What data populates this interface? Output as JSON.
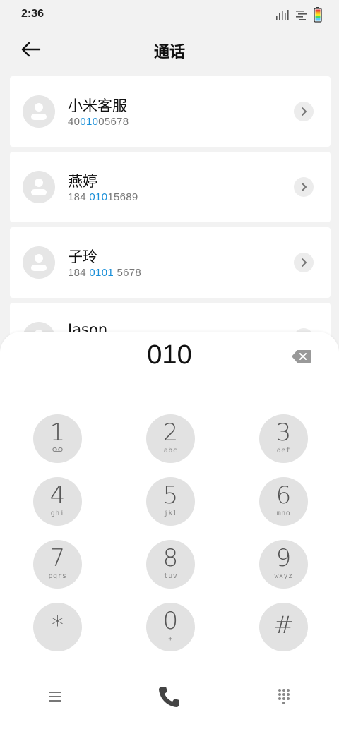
{
  "status_bar": {
    "time": "2:36",
    "icons": [
      "signal-icon",
      "wifi-icon",
      "battery-icon"
    ]
  },
  "header": {
    "title": "通话",
    "back_icon": "arrow-left-icon"
  },
  "contacts": [
    {
      "name": "小米客服",
      "number_parts": [
        "40",
        "010",
        "05678"
      ]
    },
    {
      "name": "燕婷",
      "number_parts": [
        "184 ",
        "010",
        "15689"
      ]
    },
    {
      "name": "子玲",
      "number_parts": [
        "184 ",
        "0101",
        " 5678"
      ]
    },
    {
      "name": "Jason",
      "number_parts": [
        "",
        "",
        ""
      ]
    }
  ],
  "dialer": {
    "input_value": "010",
    "keys": [
      {
        "digit": "1",
        "letters": ""
      },
      {
        "digit": "2",
        "letters": "abc"
      },
      {
        "digit": "3",
        "letters": "def"
      },
      {
        "digit": "4",
        "letters": "ghi"
      },
      {
        "digit": "5",
        "letters": "jkl"
      },
      {
        "digit": "6",
        "letters": "mno"
      },
      {
        "digit": "7",
        "letters": "pqrs"
      },
      {
        "digit": "8",
        "letters": "tuv"
      },
      {
        "digit": "9",
        "letters": "wxyz"
      },
      {
        "digit": "*",
        "letters": ""
      },
      {
        "digit": "0",
        "letters": "+"
      },
      {
        "digit": "#",
        "letters": ""
      }
    ]
  },
  "bottom_bar": {
    "left_icon": "menu-icon",
    "center_icon": "phone-call-icon",
    "right_icon": "dialpad-icon"
  },
  "colors": {
    "highlight": "#1a8fd8",
    "key_bg": "#e2e2e2",
    "page_bg": "#f2f2f2",
    "call_icon": "#444444"
  }
}
